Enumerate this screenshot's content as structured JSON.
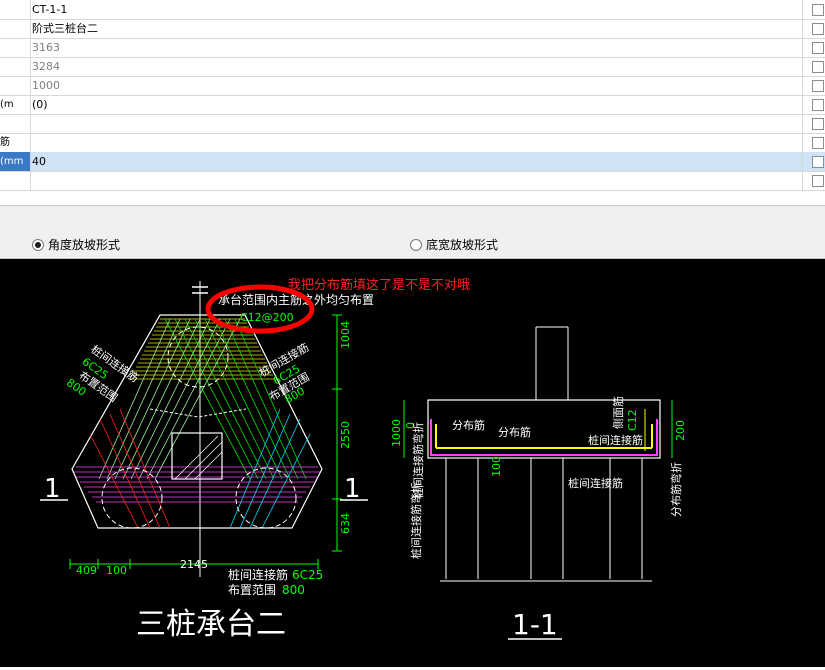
{
  "grid": {
    "rows": [
      {
        "name": "",
        "value": "CT-1-1",
        "gray": false,
        "selected": false
      },
      {
        "name": "",
        "value": "阶式三桩台二",
        "gray": false,
        "selected": false
      },
      {
        "name": "",
        "value": "3163",
        "gray": true,
        "selected": false
      },
      {
        "name": "",
        "value": "3284",
        "gray": true,
        "selected": false
      },
      {
        "name": "",
        "value": "1000",
        "gray": true,
        "selected": false
      },
      {
        "name": "m)",
        "value": "(0)",
        "gray": false,
        "selected": false
      },
      {
        "name": "",
        "value": "",
        "gray": false,
        "selected": false
      },
      {
        "name": "筋",
        "value": "",
        "gray": false,
        "selected": false
      },
      {
        "name": "mm)",
        "value": "40",
        "gray": false,
        "selected": true
      },
      {
        "name": "",
        "value": "",
        "gray": false,
        "selected": false
      }
    ]
  },
  "options": {
    "angle_slope": "角度放坡形式",
    "bottom_slope": "底宽放坡形式",
    "selected": "angle_slope"
  },
  "drawing": {
    "annotation": "我把分布筋填这了是不是不对哦",
    "note_top": "承台范围内主筋之外均匀布置",
    "rebar_spec": "C12@200",
    "left_rebar": "桩间连接筋",
    "left_rebar_spec": "6C25",
    "left_range": "布置范围",
    "left_range_val": "800",
    "right_rebar": "桩间连接筋",
    "right_rebar_spec": "6C25",
    "right_range": "布置范围",
    "right_range_val": "800",
    "dim_top": "1004",
    "dim_mid": "2550",
    "dim_bot": "634",
    "dim_409": "409",
    "dim_100": "100",
    "dim_2145": "2145",
    "bottom_rebar": "桩间连接筋",
    "bottom_rebar_spec": "6C25",
    "bottom_range": "布置范围",
    "bottom_range_val": "800",
    "section_mark_left": "1",
    "section_mark_right": "1",
    "plan_title": "三桩承台二",
    "section_title": "1-1",
    "sec_dist1": "分布筋",
    "sec_dist2": "分布筋",
    "sec_side": "侧面筋",
    "sec_side_spec": "C12",
    "sec_link": "桩间连接筋",
    "sec_link2": "桩间连接筋",
    "sec_1000": "1000",
    "sec_0": "0",
    "sec_100": "100",
    "sec_200": "200",
    "sec_left_bend": "桩间连接筋弯折",
    "sec_dist_bend": "分布筋弯折",
    "sec_left_vert": "桩间连接筋弯折"
  },
  "colors": {
    "annotation": "#ff2020",
    "green_text": "#00ff00",
    "selected_row": "#cfe2f6",
    "selected_name": "#3a78c8"
  }
}
